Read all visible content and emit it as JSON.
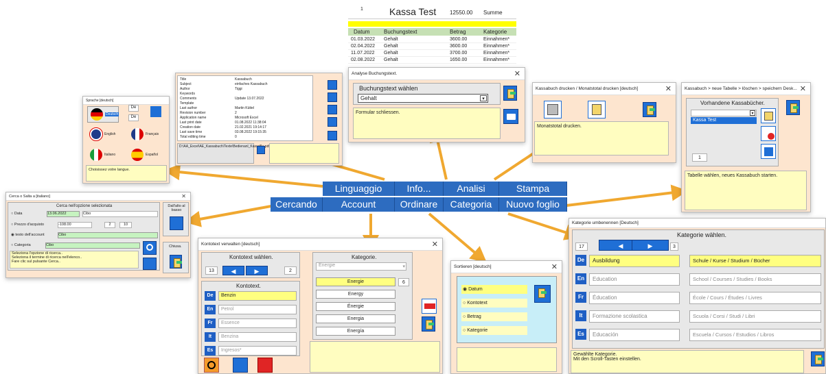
{
  "menu": {
    "row1": [
      "Linguaggio",
      "Info...",
      "Analisi",
      "Stampa"
    ],
    "row2": [
      "Cercando",
      "Account",
      "Ordinare",
      "Categoria",
      "Nuovo foglio"
    ]
  },
  "sheet": {
    "row_num": "1",
    "title": "Kassa Test",
    "total": "12550.00",
    "total_label": "Summe",
    "headers": [
      "Datum",
      "Buchungstext",
      "Betrag",
      "Kategorie"
    ],
    "rows": [
      [
        "01.03.2022",
        "Gehalt",
        "3600.00",
        "Einnahmen*"
      ],
      [
        "02.04.2022",
        "Gehalt",
        "3600.00",
        "Einnahmen*"
      ],
      [
        "11.07.2022",
        "Gehalt",
        "3700.00",
        "Einnahmen*"
      ],
      [
        "02.08.2022",
        "Gehalt",
        "1650.00",
        "Einnahmen*"
      ]
    ]
  },
  "analyse": {
    "title": "Analyse Buchungstext.",
    "label": "Buchungstext wählen",
    "value": "Gehalt",
    "info": "Formular schliessen."
  },
  "drucken": {
    "title": "Kassabuch drucken / Monatstotal drucken  [deutsch]",
    "info": "Monatstotal drucken."
  },
  "neu": {
    "title": "Kassabuch > neue Tabelle > löschen > speichern Desk...",
    "heading": "Vorhandene Kassabücher.",
    "selected": "Kassa Test",
    "count": "1",
    "info": "Tabelle wählen, neues Kassabuch starten."
  },
  "docinfo": {
    "rows": [
      [
        "Title",
        "Kassabuch"
      ],
      [
        "Subject",
        "einfaches Kassabuch"
      ],
      [
        "Author",
        "Tiggi"
      ],
      [
        "Keywords",
        ""
      ],
      [
        "Comments",
        "Update 13.07.2022"
      ],
      [
        "Template",
        ""
      ],
      [
        "Last author",
        "Martin Küttel"
      ],
      [
        "Revision number",
        "2"
      ],
      [
        "Application name",
        "Microsoft Excel"
      ],
      [
        "Last print date",
        "01.08.2022 11:38:04"
      ],
      [
        "Creation date",
        "21.02.2021 19:14:17"
      ],
      [
        "Last save time",
        "03.08.2022 19:15:35"
      ],
      [
        "Total editing time",
        "0"
      ]
    ],
    "path": "D:\\AA_Excel\\AE_Kassabuch\\Texte\\Bedienanl_KassaBu.pdf"
  },
  "sprache": {
    "title": "Sprache  [deutsch]",
    "de1": "De",
    "de2": "De",
    "deutsch": "Deutsch",
    "english": "English",
    "francais": "Français",
    "italiano": "Italiano",
    "espanol": "Español",
    "info": "Choisissez votre langue."
  },
  "cerca": {
    "title": "Cerca o Salta a  [italiano]",
    "heading": "Cerca nell'opzione selezionata",
    "dall_alto": "Dall'alto al basso",
    "opt_data": "Data",
    "data_val": "13.06.2022",
    "data_cat": "Cibo",
    "opt_prezzo": "Prezzo d'acquisto",
    "prezzo_val": "-108.00",
    "num_a": "2",
    "num_b": "10",
    "opt_testo": "testo dell'account",
    "testo_val": "Cibo",
    "opt_cat": "Categoria",
    "cat_val": "Cibo",
    "chiusa": "Chiusa.",
    "info1": "Seleziona l'opzione di ricerca..",
    "info2": "Seleziona il termine di ricerca nell'elenco..",
    "info3": "Fare clic sul pulsante Cerca.."
  },
  "konto": {
    "title": "Kontotext verwalten  [deutsch]",
    "waehlen": "Kontotext wählen.",
    "num_left": "13",
    "num_right": "2",
    "kontotext": "Kontotext.",
    "langs": [
      {
        "code": "De",
        "text": "Benzin"
      },
      {
        "code": "En",
        "text": "Petrol"
      },
      {
        "code": "Fr",
        "text": "Essence"
      },
      {
        "code": "It",
        "text": "Benzina"
      },
      {
        "code": "Es",
        "text": "Ingresos*"
      }
    ],
    "kategorie": "Kategorie.",
    "kat_dropdown": "Energie",
    "kat_num": "6",
    "kat_items": [
      "Energie",
      "Energy",
      "Énergie",
      "Energia",
      "Energía"
    ]
  },
  "sortieren": {
    "title": "Sortieren  [deutsch]",
    "options": [
      "Datum",
      "Kontotext",
      "Betrag",
      "Kategorie"
    ]
  },
  "kategorie": {
    "title": "Kategorie umbenennen  [Deutsch]",
    "heading": "Kategorie wählen.",
    "num_left": "17",
    "num_right": "3",
    "rows": [
      {
        "code": "De",
        "left": "Ausbildung",
        "right": "Schule / Kurse / Studium / Bücher"
      },
      {
        "code": "En",
        "left": "Education",
        "right": "School / Courses / Studies / Books"
      },
      {
        "code": "Fr",
        "left": "Éducation",
        "right": "École / Cours / Études / Livres"
      },
      {
        "code": "It",
        "left": "Formazione scolastica",
        "right": "Scuola / Corsi / Studi / Libri"
      },
      {
        "code": "Es",
        "left": "Educación",
        "right": "Escuela / Cursos / Estudios / Libros"
      }
    ],
    "info1": "Gewählte Kategorie.",
    "info2": "Mit den Scroll-Tasten einstellen."
  },
  "colors": {
    "accent": "#2d6cc0",
    "window_bg": "#fde5cf",
    "arrow": "#f0a830",
    "highlight": "#ffff80"
  }
}
